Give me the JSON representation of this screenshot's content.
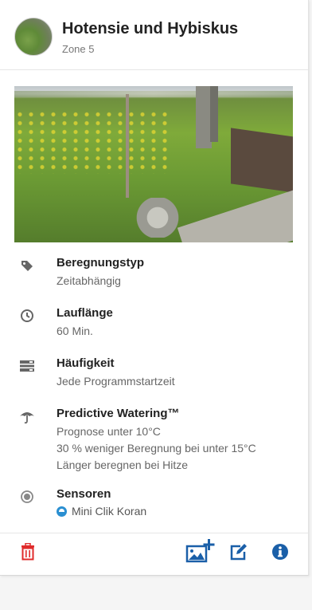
{
  "header": {
    "title": "Hotensie und Hybiskus",
    "subtitle": "Zone 5"
  },
  "details": {
    "irrigation_type": {
      "label": "Beregnungstyp",
      "value": "Zeitabhängig",
      "icon": "tag-icon"
    },
    "run_time": {
      "label": "Lauflänge",
      "value": "60 Min.",
      "icon": "clock-icon"
    },
    "frequency": {
      "label": "Häufigkeit",
      "value": "Jede Programmstartzeit",
      "icon": "list-icon"
    },
    "predictive": {
      "label": "Predictive Watering™",
      "lines": [
        "Prognose unter 10°C",
        "30 % weniger Beregnung bei unter 15°C",
        "Länger beregnen bei Hitze"
      ],
      "icon": "umbrella-icon"
    },
    "sensors": {
      "label": "Sensoren",
      "value": "Mini Clik Koran",
      "icon": "target-icon"
    }
  },
  "footer": {
    "delete_icon": "trash-icon",
    "add_photo_icon": "image-plus-icon",
    "edit_icon": "edit-icon",
    "info_icon": "info-icon"
  },
  "colors": {
    "accent_red": "#e02b2b",
    "accent_blue": "#1a5fa8",
    "icon_gray": "#666666"
  }
}
